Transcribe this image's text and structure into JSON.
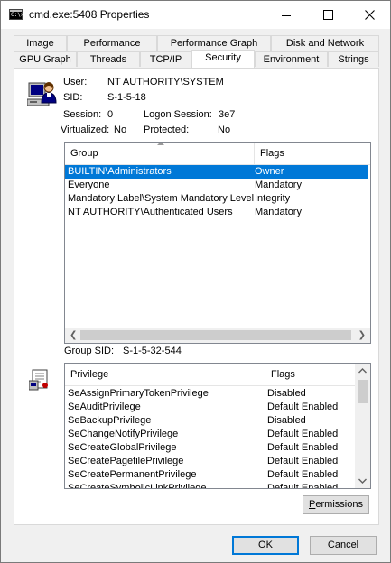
{
  "window": {
    "title": "cmd.exe:5408 Properties",
    "app_icon_text": "C:\\>"
  },
  "tabs_row1": [
    "Image",
    "Performance",
    "Performance Graph",
    "Disk and Network"
  ],
  "tabs_row2": [
    "GPU Graph",
    "Threads",
    "TCP/IP",
    "Security",
    "Environment",
    "Strings"
  ],
  "active_tab": "Security",
  "security": {
    "user_label": "User:",
    "user_value": "NT AUTHORITY\\SYSTEM",
    "sid_label": "SID:",
    "sid_value": "S-1-5-18",
    "session_label": "Session:",
    "session_value": "0",
    "logon_label": "Logon Session:",
    "logon_value": "3e7",
    "virtualized_label": "Virtualized:",
    "virtualized_value": "No",
    "protected_label": "Protected:",
    "protected_value": "No"
  },
  "groups": {
    "col_group": "Group",
    "col_flags": "Flags",
    "rows": [
      {
        "group": "BUILTIN\\Administrators",
        "flags": "Owner"
      },
      {
        "group": "Everyone",
        "flags": "Mandatory"
      },
      {
        "group": "Mandatory Label\\System Mandatory Level",
        "flags": "Integrity"
      },
      {
        "group": "NT AUTHORITY\\Authenticated Users",
        "flags": "Mandatory"
      }
    ],
    "group_sid_label": "Group SID:",
    "group_sid_value": "S-1-5-32-544"
  },
  "privileges": {
    "col_privilege": "Privilege",
    "col_flags": "Flags",
    "rows": [
      {
        "name": "SeAssignPrimaryTokenPrivilege",
        "flags": "Disabled"
      },
      {
        "name": "SeAuditPrivilege",
        "flags": "Default Enabled"
      },
      {
        "name": "SeBackupPrivilege",
        "flags": "Disabled"
      },
      {
        "name": "SeChangeNotifyPrivilege",
        "flags": "Default Enabled"
      },
      {
        "name": "SeCreateGlobalPrivilege",
        "flags": "Default Enabled"
      },
      {
        "name": "SeCreatePagefilePrivilege",
        "flags": "Default Enabled"
      },
      {
        "name": "SeCreatePermanentPrivilege",
        "flags": "Default Enabled"
      },
      {
        "name": "SeCreateSymbolicLinkPrivilege",
        "flags": "Default Enabled"
      }
    ]
  },
  "buttons": {
    "permissions_accel": "P",
    "permissions_rest": "ermissions",
    "ok_accel": "O",
    "ok_rest": "K",
    "cancel_pre": "",
    "cancel_accel": "C",
    "cancel_rest": "ancel"
  },
  "colors": {
    "selection": "#0078d7",
    "window_bg": "#f0f0f0"
  }
}
